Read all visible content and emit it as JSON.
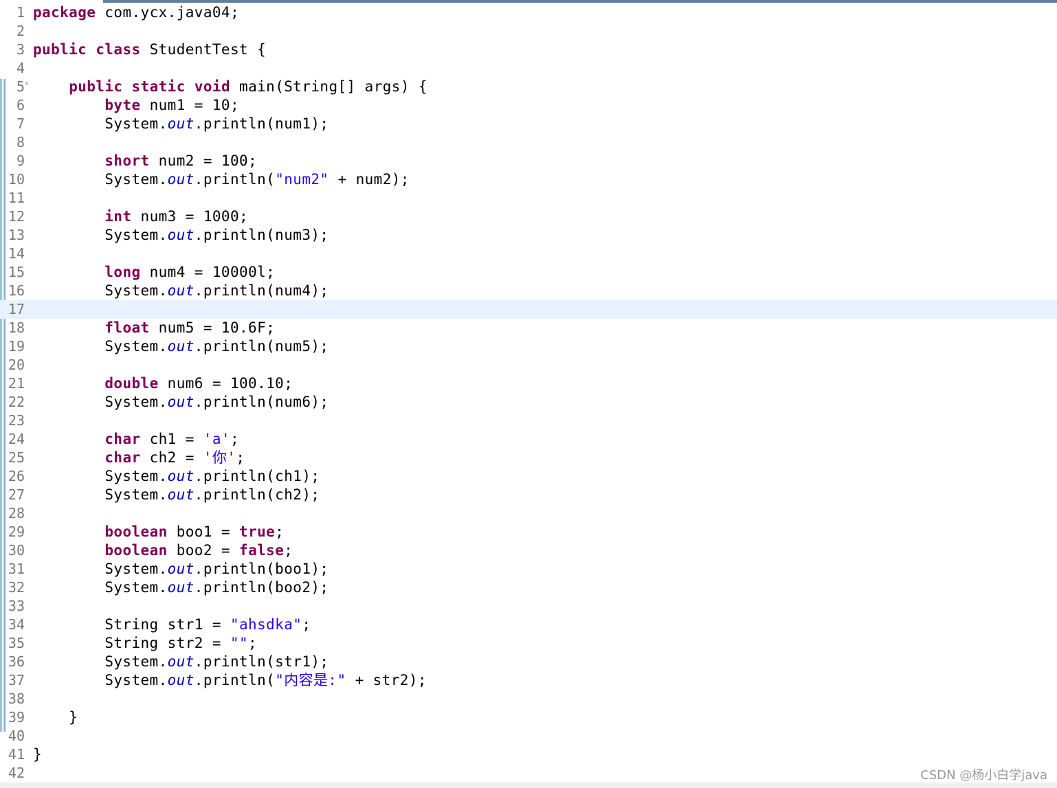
{
  "editor": {
    "current_line": 17,
    "colors": {
      "keyword": "#7f0055",
      "string": "#2a00ff",
      "static_field": "#0000c0",
      "line_number": "#787878",
      "current_line_bg": "#e8f2fe"
    },
    "lines": [
      {
        "n": "1",
        "tokens": [
          {
            "t": "package",
            "k": "kw"
          },
          {
            "t": " com.ycx.java04;"
          }
        ]
      },
      {
        "n": "2",
        "tokens": []
      },
      {
        "n": "3",
        "tokens": [
          {
            "t": "public",
            "k": "kw"
          },
          {
            "t": " "
          },
          {
            "t": "class",
            "k": "kw"
          },
          {
            "t": " StudentTest {"
          }
        ]
      },
      {
        "n": "4",
        "tokens": []
      },
      {
        "n": "5",
        "fold": true,
        "tokens": [
          {
            "t": "    "
          },
          {
            "t": "public",
            "k": "kw"
          },
          {
            "t": " "
          },
          {
            "t": "static",
            "k": "kw"
          },
          {
            "t": " "
          },
          {
            "t": "void",
            "k": "kw"
          },
          {
            "t": " main(String[] args) {"
          }
        ]
      },
      {
        "n": "6",
        "tokens": [
          {
            "t": "        "
          },
          {
            "t": "byte",
            "k": "kw"
          },
          {
            "t": " num1 = 10;"
          }
        ]
      },
      {
        "n": "7",
        "tokens": [
          {
            "t": "        System."
          },
          {
            "t": "out",
            "k": "field"
          },
          {
            "t": ".println(num1);"
          }
        ]
      },
      {
        "n": "8",
        "tokens": []
      },
      {
        "n": "9",
        "tokens": [
          {
            "t": "        "
          },
          {
            "t": "short",
            "k": "kw"
          },
          {
            "t": " num2 = 100;"
          }
        ]
      },
      {
        "n": "10",
        "tokens": [
          {
            "t": "        System."
          },
          {
            "t": "out",
            "k": "field"
          },
          {
            "t": ".println("
          },
          {
            "t": "\"num2\"",
            "k": "str"
          },
          {
            "t": " + num2);"
          }
        ]
      },
      {
        "n": "11",
        "tokens": []
      },
      {
        "n": "12",
        "tokens": [
          {
            "t": "        "
          },
          {
            "t": "int",
            "k": "kw"
          },
          {
            "t": " num3 = 1000;"
          }
        ]
      },
      {
        "n": "13",
        "tokens": [
          {
            "t": "        System."
          },
          {
            "t": "out",
            "k": "field"
          },
          {
            "t": ".println(num3);"
          }
        ]
      },
      {
        "n": "14",
        "tokens": []
      },
      {
        "n": "15",
        "tokens": [
          {
            "t": "        "
          },
          {
            "t": "long",
            "k": "kw"
          },
          {
            "t": " num4 = 10000l;"
          }
        ]
      },
      {
        "n": "16",
        "tokens": [
          {
            "t": "        System."
          },
          {
            "t": "out",
            "k": "field"
          },
          {
            "t": ".println(num4);"
          }
        ]
      },
      {
        "n": "17",
        "tokens": []
      },
      {
        "n": "18",
        "tokens": [
          {
            "t": "        "
          },
          {
            "t": "float",
            "k": "kw"
          },
          {
            "t": " num5 = 10.6F;"
          }
        ]
      },
      {
        "n": "19",
        "tokens": [
          {
            "t": "        System."
          },
          {
            "t": "out",
            "k": "field"
          },
          {
            "t": ".println(num5);"
          }
        ]
      },
      {
        "n": "20",
        "tokens": []
      },
      {
        "n": "21",
        "tokens": [
          {
            "t": "        "
          },
          {
            "t": "double",
            "k": "kw"
          },
          {
            "t": " num6 = 100.10;"
          }
        ]
      },
      {
        "n": "22",
        "tokens": [
          {
            "t": "        System."
          },
          {
            "t": "out",
            "k": "field"
          },
          {
            "t": ".println(num6);"
          }
        ]
      },
      {
        "n": "23",
        "tokens": []
      },
      {
        "n": "24",
        "tokens": [
          {
            "t": "        "
          },
          {
            "t": "char",
            "k": "kw"
          },
          {
            "t": " ch1 = "
          },
          {
            "t": "'a'",
            "k": "str"
          },
          {
            "t": ";"
          }
        ]
      },
      {
        "n": "25",
        "tokens": [
          {
            "t": "        "
          },
          {
            "t": "char",
            "k": "kw"
          },
          {
            "t": " ch2 = "
          },
          {
            "t": "'你'",
            "k": "str"
          },
          {
            "t": ";"
          }
        ]
      },
      {
        "n": "26",
        "tokens": [
          {
            "t": "        System."
          },
          {
            "t": "out",
            "k": "field"
          },
          {
            "t": ".println(ch1);"
          }
        ]
      },
      {
        "n": "27",
        "tokens": [
          {
            "t": "        System."
          },
          {
            "t": "out",
            "k": "field"
          },
          {
            "t": ".println(ch2);"
          }
        ]
      },
      {
        "n": "28",
        "tokens": []
      },
      {
        "n": "29",
        "tokens": [
          {
            "t": "        "
          },
          {
            "t": "boolean",
            "k": "kw"
          },
          {
            "t": " boo1 = "
          },
          {
            "t": "true",
            "k": "kw"
          },
          {
            "t": ";"
          }
        ]
      },
      {
        "n": "30",
        "tokens": [
          {
            "t": "        "
          },
          {
            "t": "boolean",
            "k": "kw"
          },
          {
            "t": " boo2 = "
          },
          {
            "t": "false",
            "k": "kw"
          },
          {
            "t": ";"
          }
        ]
      },
      {
        "n": "31",
        "tokens": [
          {
            "t": "        System."
          },
          {
            "t": "out",
            "k": "field"
          },
          {
            "t": ".println(boo1);"
          }
        ]
      },
      {
        "n": "32",
        "tokens": [
          {
            "t": "        System."
          },
          {
            "t": "out",
            "k": "field"
          },
          {
            "t": ".println(boo2);"
          }
        ]
      },
      {
        "n": "33",
        "tokens": []
      },
      {
        "n": "34",
        "tokens": [
          {
            "t": "        String str1 = "
          },
          {
            "t": "\"ahsdka\"",
            "k": "str"
          },
          {
            "t": ";"
          }
        ]
      },
      {
        "n": "35",
        "tokens": [
          {
            "t": "        String str2 = "
          },
          {
            "t": "\"\"",
            "k": "str"
          },
          {
            "t": ";"
          }
        ]
      },
      {
        "n": "36",
        "tokens": [
          {
            "t": "        System."
          },
          {
            "t": "out",
            "k": "field"
          },
          {
            "t": ".println(str1);"
          }
        ]
      },
      {
        "n": "37",
        "tokens": [
          {
            "t": "        System."
          },
          {
            "t": "out",
            "k": "field"
          },
          {
            "t": ".println("
          },
          {
            "t": "\"内容是:\"",
            "k": "str"
          },
          {
            "t": " + str2);"
          }
        ]
      },
      {
        "n": "38",
        "tokens": []
      },
      {
        "n": "39",
        "tokens": [
          {
            "t": "    }"
          }
        ]
      },
      {
        "n": "40",
        "tokens": []
      },
      {
        "n": "41",
        "tokens": [
          {
            "t": "}"
          }
        ]
      },
      {
        "n": "42",
        "tokens": []
      }
    ]
  },
  "watermark": "CSDN @杨小白学java"
}
